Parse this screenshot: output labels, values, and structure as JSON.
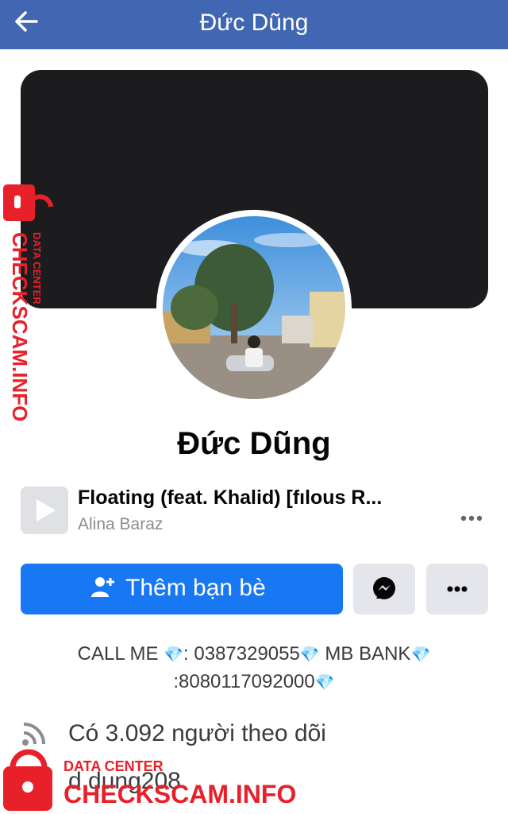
{
  "header": {
    "title": "Đức Dũng"
  },
  "profile": {
    "name": "Đức Dũng"
  },
  "music": {
    "title": "Floating (feat. Khalid) [fılous R...",
    "artist": "Alina Baraz"
  },
  "actions": {
    "add_friend_label": "Thêm bạn bè"
  },
  "bio": {
    "line1": ": 0387329055",
    "line1b": " MB BANK",
    "prefix": "CALL ME ",
    "line2": ":8080117092000"
  },
  "details": {
    "followers": "Có 3.092 người theo dõi",
    "username": "d.dung208"
  },
  "watermark": {
    "brand": "CHECKSCAM.INFO",
    "tagline": "DATA CENTER"
  },
  "colors": {
    "header": "#4267b2",
    "primary": "#1877f2",
    "watermark": "#e8202a"
  }
}
